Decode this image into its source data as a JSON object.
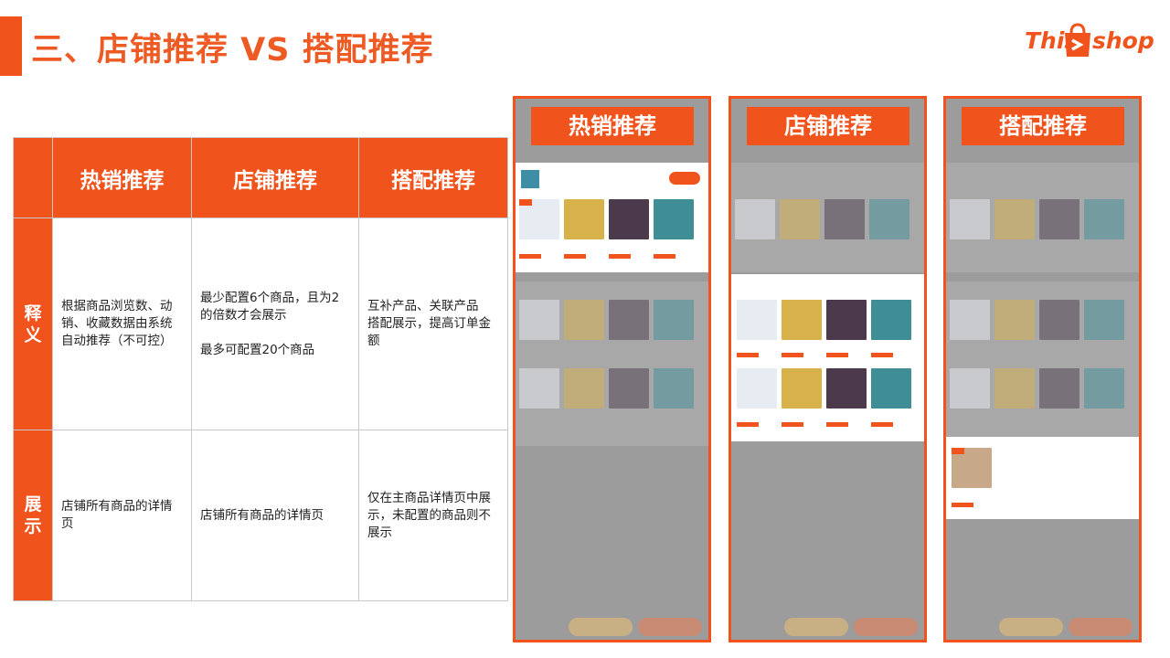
{
  "header": {
    "title": "三、店铺推荐 VS 搭配推荐",
    "logo_this": "This",
    "logo_shop": "shop"
  },
  "table": {
    "headers": [
      "热销推荐",
      "店铺推荐",
      "搭配推荐"
    ],
    "rows": [
      {
        "label": "释义",
        "cells": [
          "根据商品浏览数、动销、收藏数据由系统自动推荐（不可控）",
          "最少配置6个商品，且为2的倍数才会展示\n\n最多可配置20个商品",
          "互补产品、关联产品\n搭配展示，提高订单金额"
        ]
      },
      {
        "label": "展示",
        "cells": [
          "店铺所有商品的详情页",
          "店铺所有商品的详情页",
          "仅在主商品详情页中展示，未配置的商品则不展示"
        ]
      }
    ]
  },
  "phones": [
    {
      "label": "热销推荐"
    },
    {
      "label": "店铺推荐"
    },
    {
      "label": "搭配推荐"
    }
  ],
  "colors": {
    "accent": "#f1531c"
  }
}
